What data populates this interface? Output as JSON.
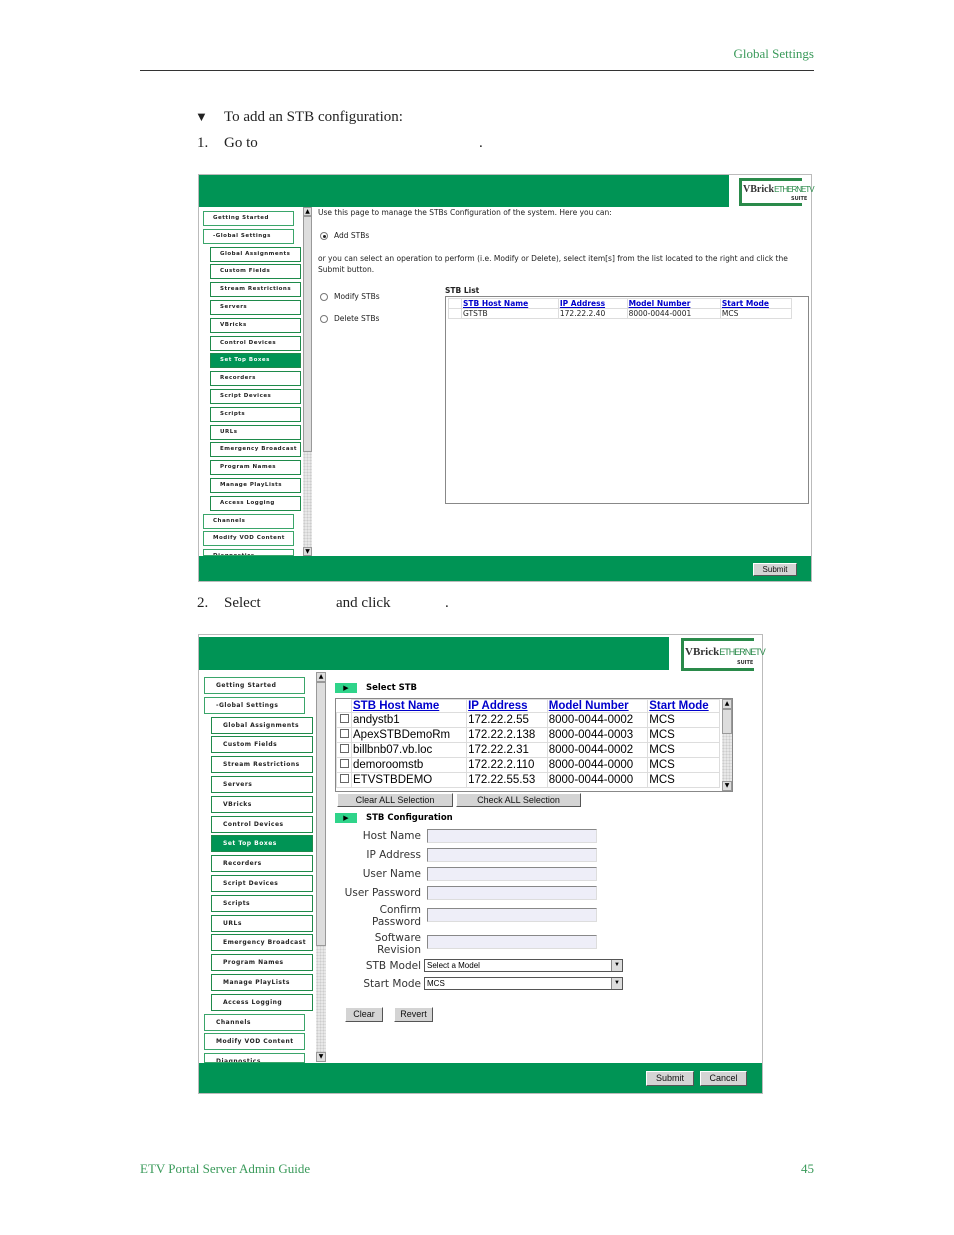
{
  "header": {
    "section": "Global Settings"
  },
  "intro": {
    "bullet": "▼",
    "heading": "To add an STB configuration:"
  },
  "steps": [
    {
      "num": "1.",
      "text": "Go to",
      "tail": "."
    },
    {
      "num": "2.",
      "text": "Select",
      "mid": "and click",
      "tail": "."
    }
  ],
  "logo": {
    "brand": "VBrick",
    "product": "ETHERNETV",
    "suite": "SUITE"
  },
  "nav": [
    {
      "label": "Getting Started",
      "level": 0
    },
    {
      "label": "-Global Settings",
      "level": 0
    },
    {
      "label": "Global Assignments",
      "level": 1
    },
    {
      "label": "Custom Fields",
      "level": 1
    },
    {
      "label": "Stream Restrictions",
      "level": 1
    },
    {
      "label": "Servers",
      "level": 1
    },
    {
      "label": "VBricks",
      "level": 1
    },
    {
      "label": "Control Devices",
      "level": 1
    },
    {
      "label": "Set Top Boxes",
      "level": 1,
      "selected": true
    },
    {
      "label": "Recorders",
      "level": 1
    },
    {
      "label": "Script Devices",
      "level": 1
    },
    {
      "label": "Scripts",
      "level": 1
    },
    {
      "label": "URLs",
      "level": 1
    },
    {
      "label": "Emergency Broadcast",
      "level": 1
    },
    {
      "label": "Program Names",
      "level": 1
    },
    {
      "label": "Manage PlayLists",
      "level": 1
    },
    {
      "label": "Access Logging",
      "level": 1
    },
    {
      "label": "Channels",
      "level": 0
    },
    {
      "label": "Modify VOD Content",
      "level": 0
    },
    {
      "label": "Diagnostics",
      "level": 0
    }
  ],
  "screen1": {
    "intro": "Use this page to manage the STBs Configuration of the system. Here you can:",
    "add_option": "Add STBs",
    "or_text": "or you can select an operation to perform (i.e. Modify or Delete), select item[s] from the list located to the right and click the Submit button.",
    "modify_option": "Modify STBs",
    "delete_option": "Delete STBs",
    "list_title": "STB List",
    "columns": [
      "STB Host Name",
      "IP Address",
      "Model Number",
      "Start Mode"
    ],
    "rows": [
      [
        "GTSTB",
        "172.22.2.40",
        "8000-0044-0001",
        "MCS"
      ]
    ],
    "submit": "Submit"
  },
  "screen2": {
    "select_title": "Select STB",
    "columns": [
      "STB Host Name",
      "IP Address",
      "Model Number",
      "Start Mode"
    ],
    "rows": [
      [
        "andystb1",
        "172.22.2.55",
        "8000-0044-0002",
        "MCS"
      ],
      [
        "ApexSTBDemoRm",
        "172.22.2.138",
        "8000-0044-0003",
        "MCS"
      ],
      [
        "billbnb07.vb.loc",
        "172.22.2.31",
        "8000-0044-0002",
        "MCS"
      ],
      [
        "demoroomstb",
        "172.22.2.110",
        "8000-0044-0000",
        "MCS"
      ],
      [
        "ETVSTBDEMO",
        "172.22.55.53",
        "8000-0044-0000",
        "MCS"
      ]
    ],
    "clear_all": "Clear ALL Selection",
    "check_all": "Check ALL Selection",
    "config_title": "STB Configuration",
    "fields": {
      "host_name": "Host Name",
      "ip_address": "IP Address",
      "user_name": "User Name",
      "user_password": "User Password",
      "confirm_password": "Confirm Password",
      "software_revision": "Software Revision",
      "stb_model": "STB Model",
      "start_mode": "Start Mode"
    },
    "stb_model_value": "Select a Model",
    "start_mode_value": "MCS",
    "clear": "Clear",
    "revert": "Revert",
    "submit": "Submit",
    "cancel": "Cancel"
  },
  "footer": {
    "title": "ETV Portal Server Admin Guide",
    "page": "45"
  },
  "colors": {
    "brand_green": "#009455",
    "header_text": "#3a9a5a",
    "link": "#0000cc"
  }
}
